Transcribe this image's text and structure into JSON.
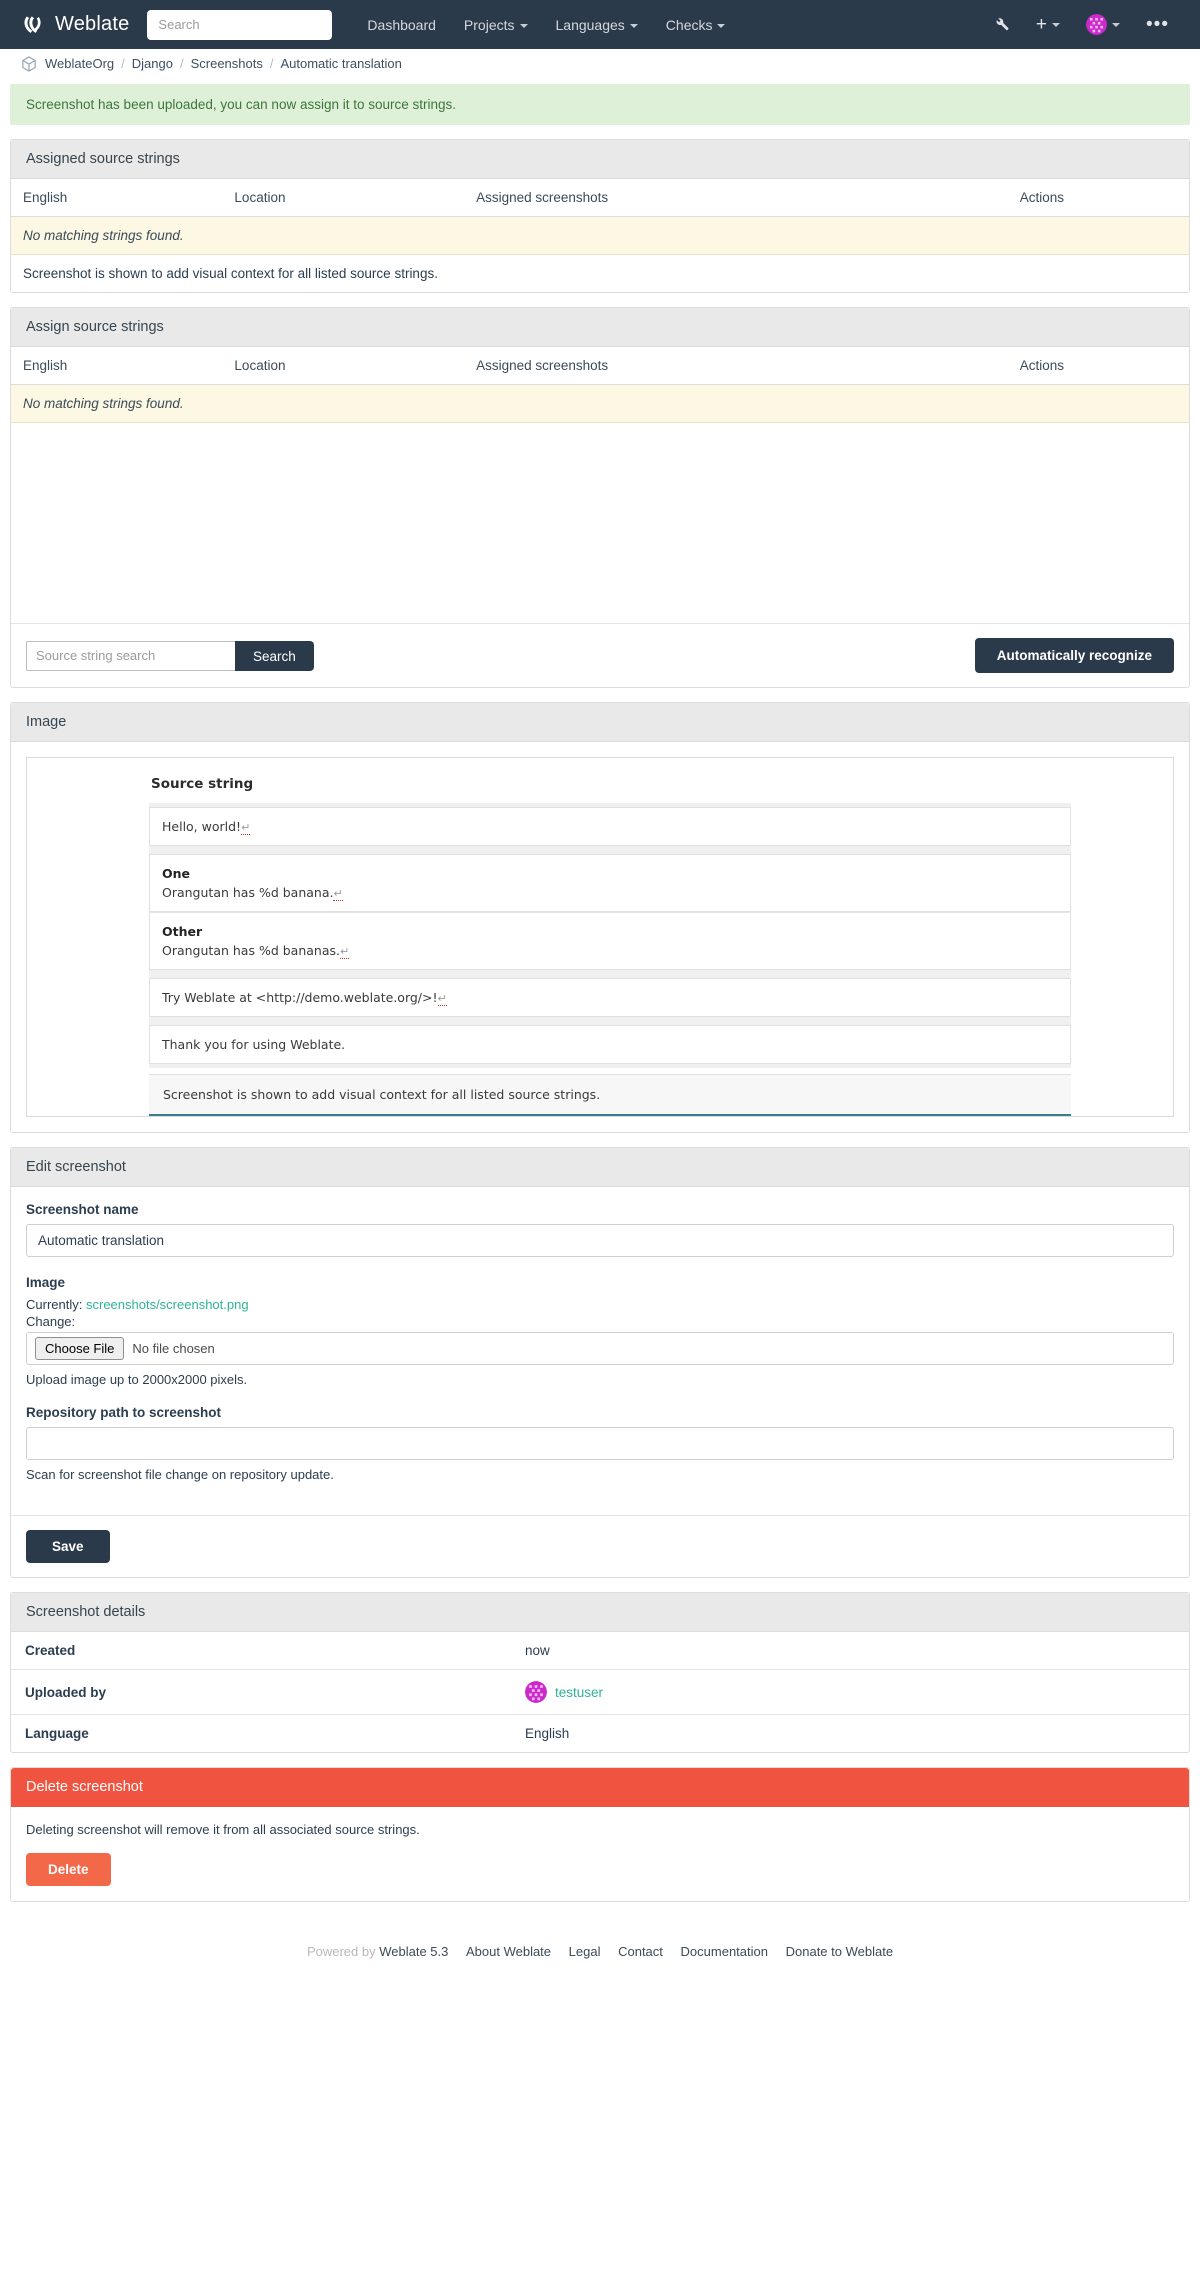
{
  "navbar": {
    "brand": "Weblate",
    "search_placeholder": "Search",
    "links": [
      {
        "label": "Dashboard",
        "dropdown": false
      },
      {
        "label": "Projects",
        "dropdown": true
      },
      {
        "label": "Languages",
        "dropdown": true
      },
      {
        "label": "Checks",
        "dropdown": true
      }
    ],
    "tools_icon": "wrench-icon",
    "add_icon": "plus-icon",
    "avatar_icon": "user-avatar",
    "more_icon": "ellipsis-icon"
  },
  "breadcrumb": {
    "icon": "project-cube-icon",
    "items": [
      "WeblateOrg",
      "Django",
      "Screenshots",
      "Automatic translation"
    ],
    "separator": "/"
  },
  "alert": {
    "message": "Screenshot has been uploaded, you can now assign it to source strings."
  },
  "assigned_panel": {
    "title": "Assigned source strings",
    "columns": [
      "English",
      "Location",
      "Assigned screenshots",
      "Actions"
    ],
    "empty_message": "No matching strings found.",
    "note": "Screenshot is shown to add visual context for all listed source strings."
  },
  "assign_panel": {
    "title": "Assign source strings",
    "columns": [
      "English",
      "Location",
      "Assigned screenshots",
      "Actions"
    ],
    "empty_message": "No matching strings found.",
    "search_placeholder": "Source string search",
    "search_value": "",
    "search_button": "Search",
    "auto_recognize_button": "Automatically recognize"
  },
  "image_panel": {
    "title": "Image",
    "screenshot": {
      "heading": "Source string",
      "return_glyph": "↵",
      "rows": [
        {
          "type": "single",
          "text": "Hello, world!",
          "has_return": true
        },
        {
          "type": "plural",
          "label": "One",
          "text": "Orangutan has %d banana.",
          "has_return": true
        },
        {
          "type": "plural",
          "label": "Other",
          "text": "Orangutan has %d bananas.",
          "has_return": true
        },
        {
          "type": "single",
          "text": "Try Weblate at <http://demo.weblate.org/>!",
          "has_return": true
        },
        {
          "type": "single",
          "text": "Thank you for using Weblate.",
          "has_return": false
        }
      ],
      "footer": "Screenshot is shown to add visual context for all listed source strings."
    }
  },
  "edit_panel": {
    "title": "Edit screenshot",
    "name_label": "Screenshot name",
    "name_value": "Automatic translation",
    "image_label": "Image",
    "currently_label": "Currently:",
    "currently_file": "screenshots/screenshot.png",
    "change_label": "Change:",
    "choose_file_button": "Choose File",
    "no_file_chosen": "No file chosen",
    "upload_help": "Upload image up to 2000x2000 pixels.",
    "repo_label": "Repository path to screenshot",
    "repo_value": "",
    "repo_help": "Scan for screenshot file change on repository update.",
    "save_button": "Save"
  },
  "details_panel": {
    "title": "Screenshot details",
    "rows": [
      {
        "label": "Created",
        "value": "now",
        "type": "text"
      },
      {
        "label": "Uploaded by",
        "value": "testuser",
        "type": "user"
      },
      {
        "label": "Language",
        "value": "English",
        "type": "text"
      }
    ]
  },
  "delete_panel": {
    "title": "Delete screenshot",
    "description": "Deleting screenshot will remove it from all associated source strings.",
    "delete_button": "Delete"
  },
  "footer": {
    "powered_by": "Powered by",
    "version": "Weblate 5.3",
    "links": [
      "About Weblate",
      "Legal",
      "Contact",
      "Documentation",
      "Donate to Weblate"
    ]
  },
  "colors": {
    "navbar": "#2b3a4a",
    "accent_green": "#2eb398",
    "alert_success_bg": "#dff0d8",
    "alert_success_fg": "#3c763d",
    "empty_row_bg": "#fcf8e3",
    "danger": "#f0533f",
    "danger_button": "#f26849",
    "avatar": "#c92ac9"
  }
}
